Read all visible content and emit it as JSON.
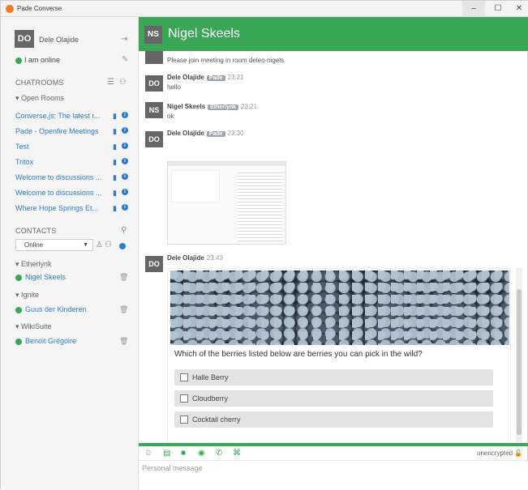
{
  "window": {
    "title": "Pade Converse",
    "minimize": "–",
    "maximize": "☐",
    "close": "✕"
  },
  "me": {
    "initials": "DO",
    "name": "Dele Olajide",
    "presence": "I am online"
  },
  "chatrooms": {
    "heading": "CHATROOMS",
    "group": "Open Rooms",
    "items": [
      {
        "label": "Converse.js: The latest r..."
      },
      {
        "label": "Pade - Openfire Meetings"
      },
      {
        "label": "Test"
      },
      {
        "label": "Tritox"
      },
      {
        "label": "Welcome to discussions ..."
      },
      {
        "label": "Welcome to discussions ..."
      },
      {
        "label": "Where Hope Springs Et..."
      }
    ]
  },
  "contacts": {
    "heading": "CONTACTS",
    "status_value": "Online",
    "groups": [
      {
        "name": "Etherlynk",
        "contacts": [
          {
            "name": "Nigel Skeels"
          }
        ]
      },
      {
        "name": "Ignite",
        "contacts": [
          {
            "name": "Guus der Kinderen"
          }
        ]
      },
      {
        "name": "WikiSuite",
        "contacts": [
          {
            "name": "Benoit Grégoire"
          }
        ]
      }
    ]
  },
  "chat": {
    "initials": "NS",
    "name": "Nigel Skeels",
    "partial_msg": "Please join meeting in room deleo-nigels",
    "messages": [
      {
        "initials": "DO",
        "author": "Dele Olajide",
        "badge": "Pade",
        "time": "23:21",
        "text": "hello"
      },
      {
        "initials": "NS",
        "author": "Nigel Skeels",
        "badge": "Etherlynk",
        "time": "23:21",
        "text": "ok"
      },
      {
        "initials": "DO",
        "author": "Dele Olajide",
        "badge": "Pade",
        "time": "23:30",
        "text": ""
      },
      {
        "initials": "DO",
        "author": "Dele Olajide",
        "badge": "",
        "time": "23:43",
        "text": ""
      }
    ],
    "poll": {
      "question": "Which of the berries listed below are berries you can pick in the wild?",
      "options": [
        {
          "label": "Halle Berry"
        },
        {
          "label": "Cloudberry"
        },
        {
          "label": "Cocktail cherry"
        }
      ]
    },
    "encryption": "unencrypted",
    "composer_placeholder": "Personal message"
  },
  "colors": {
    "accent": "#3aa757",
    "link": "#2f7cc5"
  }
}
